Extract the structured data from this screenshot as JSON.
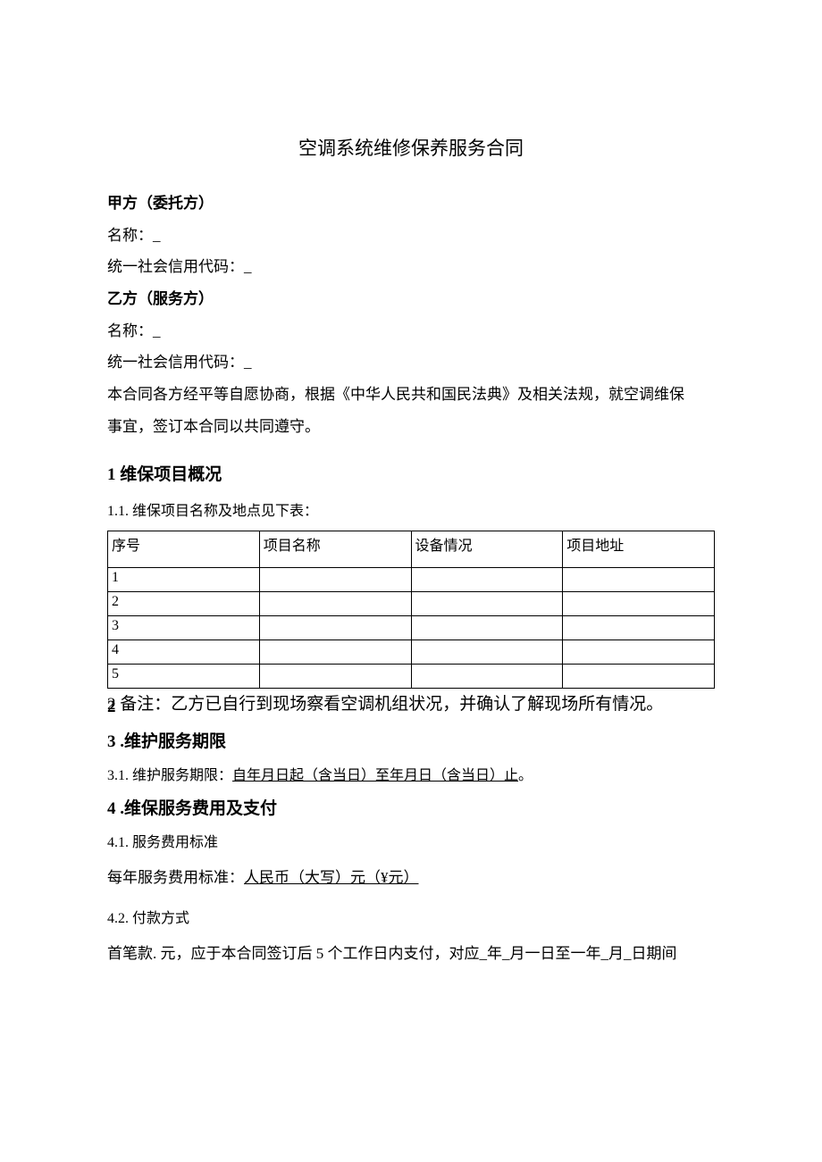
{
  "title": "空调系统维修保养服务合同",
  "partyA": {
    "heading": "甲方（委托方）",
    "nameLabel": "名称：_",
    "codeLabel": "统一社会信用代码：_"
  },
  "partyB": {
    "heading": "乙方（服务方）",
    "nameLabel": "名称：_",
    "codeLabel": "统一社会信用代码：_"
  },
  "preamble1": "本合同各方经平等自愿协商，根据《中华人民共和国民法典》及相关法规，就空调维保",
  "preamble2": "事宜，签订本合同以共同遵守。",
  "section1": {
    "heading": "1 维保项目概况",
    "sub": "1.1.   维保项目名称及地点见下表："
  },
  "table": {
    "headers": [
      "序号",
      "项目名称",
      "设备情况",
      "项目地址"
    ],
    "rows": [
      "1",
      "2",
      "3",
      "4",
      "5"
    ]
  },
  "section2": "2  备注：乙方已自行到现场察看空调机组状况，并确认了解现场所有情况。",
  "section3": {
    "heading": "3 .维护服务期限",
    "sub_prefix": "3.1.   维护服务期限：",
    "sub_underlined": "自年月日起（含当日）至年月日（含当日）止",
    "sub_suffix": "。"
  },
  "section4": {
    "heading": "4 .维保服务费用及支付",
    "sub41": "4.1.   服务费用标准",
    "fee_prefix": "每年服务费用标准：",
    "fee_underlined": "人民币（大写）元（¥元）",
    "sub42": "4.2.   付款方式",
    "payment": "首笔款. 元，应于本合同签订后 5 个工作日内支付，对应_年_月一日至一年_月_日期间"
  }
}
